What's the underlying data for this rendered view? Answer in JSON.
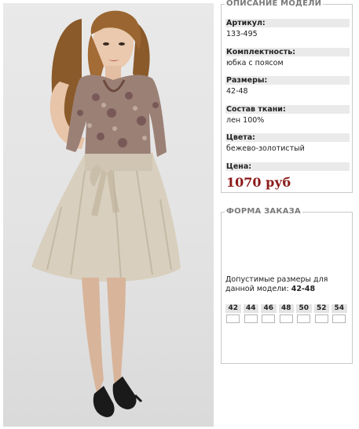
{
  "description": {
    "legend": "ОПИСАНИЕ МОДЕЛИ",
    "rows": [
      {
        "label": "Артикул:",
        "value": "133-495"
      },
      {
        "label": "Комплектность:",
        "value": "юбка с поясом"
      },
      {
        "label": "Размеры:",
        "value": "42-48"
      },
      {
        "label": "Состав ткани:",
        "value": "лен 100%"
      },
      {
        "label": "Цвета:",
        "value": "бежево-золотистый"
      }
    ],
    "price_label": "Цена:",
    "price": "1070 руб",
    "price_color": "#8b1a1a"
  },
  "order": {
    "legend": "ФОРМА ЗАКАЗА",
    "sizes_text": "Допустимые размеры для данной модели:",
    "sizes_range": "42-48",
    "sizes": [
      "42",
      "44",
      "46",
      "48",
      "50",
      "52",
      "54"
    ]
  },
  "photo": {
    "subject": "model-in-beige-skirt-and-paisley-blouse"
  }
}
